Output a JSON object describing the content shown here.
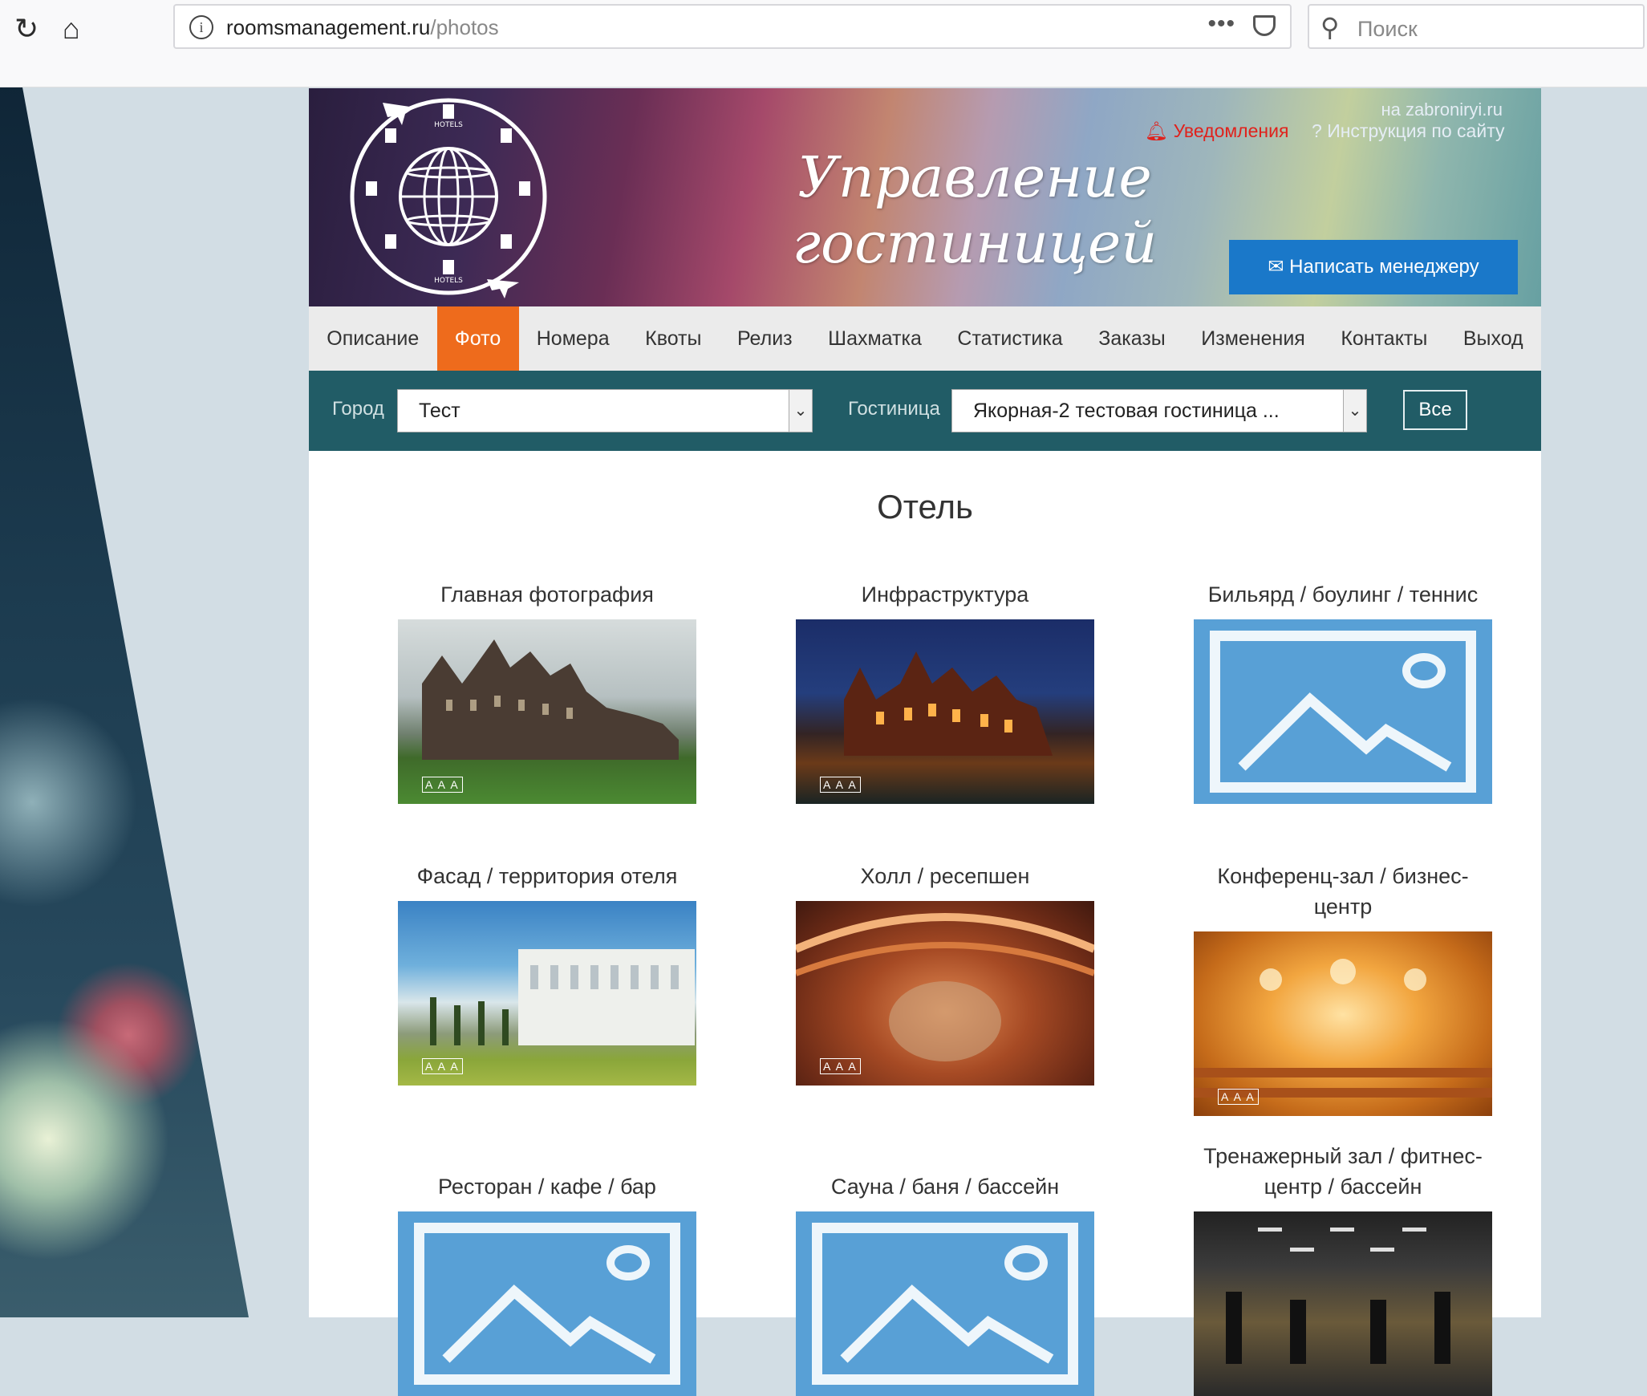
{
  "browser": {
    "url_host": "roomsmanagement.ru",
    "url_path": "/photos",
    "search_placeholder": "Поиск",
    "more_icon": "•••"
  },
  "header": {
    "site_link": "на zabroniryi.ru",
    "notifications": "Уведомления",
    "help": "Инструкция по сайту",
    "title": "Управление гостиницей",
    "write_manager": "Написать менеджеру",
    "logo_hotel_label": "HOTELS"
  },
  "tabs": [
    {
      "label": "Описание",
      "active": false
    },
    {
      "label": "Фото",
      "active": true
    },
    {
      "label": "Номера",
      "active": false
    },
    {
      "label": "Квоты",
      "active": false
    },
    {
      "label": "Релиз",
      "active": false
    },
    {
      "label": "Шахматка",
      "active": false
    },
    {
      "label": "Статистика",
      "active": false
    },
    {
      "label": "Заказы",
      "active": false
    },
    {
      "label": "Изменения",
      "active": false
    },
    {
      "label": "Контакты",
      "active": false
    },
    {
      "label": "Выход",
      "active": false
    }
  ],
  "filter": {
    "city_label": "Город",
    "city_value": "Тест",
    "hotel_label": "Гостиница",
    "hotel_value": "Якорная-2 тестовая гостиница ...",
    "all_button": "Все"
  },
  "section_title": "Отель",
  "photos": [
    {
      "caption": "Главная фотография",
      "image": "photo",
      "watermark": "A A A"
    },
    {
      "caption": "Инфраструктура",
      "image": "photo",
      "watermark": "A A A"
    },
    {
      "caption": "Бильярд / боулинг / теннис",
      "image": "placeholder"
    },
    {
      "caption": "Фасад / территория отеля",
      "image": "photo",
      "watermark": "A A A"
    },
    {
      "caption": "Холл / ресепшен",
      "image": "photo",
      "watermark": "A A A"
    },
    {
      "caption": "Конференц-зал / бизнес-центр",
      "image": "photo",
      "watermark": "A A A"
    },
    {
      "caption": "Ресторан / кафе / бар",
      "image": "placeholder"
    },
    {
      "caption": "Сауна / баня / бассейн",
      "image": "placeholder"
    },
    {
      "caption": "Тренажерный зал / фитнес-центр / бассейн",
      "image": "photo"
    }
  ],
  "colors": {
    "accent_tab": "#ee6b1c",
    "filter_bar": "#215c66",
    "button_blue": "#1a78c9",
    "notification_red": "#e0221c"
  }
}
